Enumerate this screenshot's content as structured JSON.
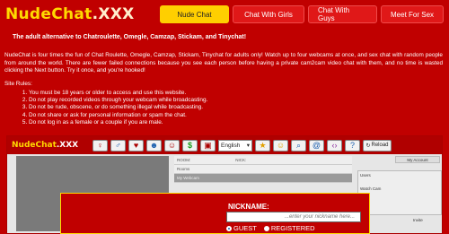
{
  "logo": {
    "part1": "NudeChat",
    "part2": ".XXX"
  },
  "nav": {
    "tabs": [
      {
        "label": "Nude Chat"
      },
      {
        "label": "Chat With Girls"
      },
      {
        "label": "Chat With Guys"
      },
      {
        "label": "Meet For Sex"
      }
    ]
  },
  "tagline": "The adult alternative to Chatroulette, Omegle, Camzap, Stickam, and Tinychat!",
  "intro": "NudeChat is four times the fun of Chat Roulette, Omegle, Camzap, Stickam, Tinychat for adults only! Watch up to four webcams at once, and sex chat with random people from around the world. There are fewer failed connections because you see each person before having a private cam2cam video chat with them, and no time is wasted clicking the Next button. Try it once, and you're hooked!",
  "rules_title": "Site Rules:",
  "rules": [
    "You must be 18 years or older to access and use this website.",
    "Do not play recorded videos through your webcam while broadcasting.",
    "Do not be rude, obscene, or do something illegal while broadcasting.",
    "Do not share or ask for personal information or spam the chat.",
    "Do not log in as a female or a couple if you are male."
  ],
  "app": {
    "logo_part1": "NudeChat",
    "logo_part2": ".XXX",
    "language": "English",
    "reload": "Reload",
    "room_label": "ROOM:",
    "nick_label": "NICK:",
    "rooms_label": "Rooms",
    "my_webcam": "My Webcam",
    "my_account": "My Account",
    "users": "Users",
    "watch_cam": "Watch Cam",
    "invite": "Invite"
  },
  "login": {
    "label": "NICKNAME:",
    "placeholder": "...enter your nickname here...",
    "options": [
      "GUEST",
      "REGISTERED"
    ],
    "selected": "GUEST"
  },
  "colors": {
    "background": "#c00000",
    "accent": "#ffcf00",
    "logo": "#ffd900"
  }
}
